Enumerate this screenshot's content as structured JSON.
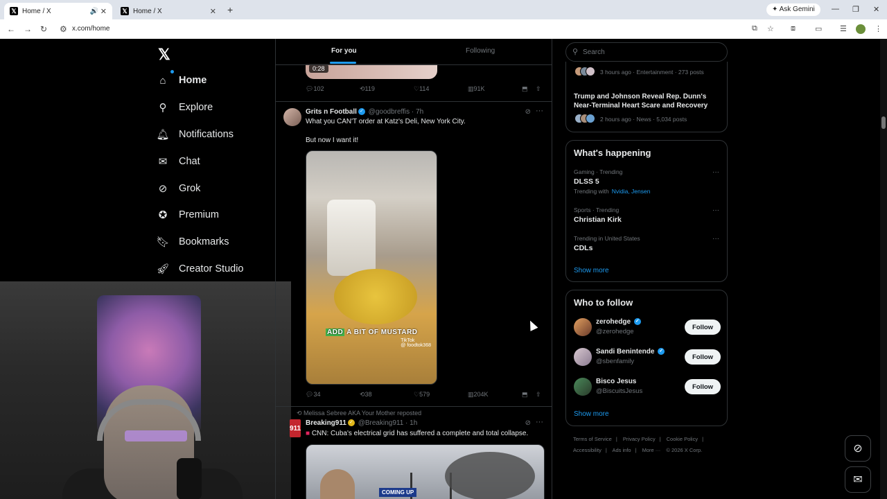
{
  "browser": {
    "tabs": [
      {
        "title": "Home / X",
        "active": true
      },
      {
        "title": "Home / X",
        "active": false
      }
    ],
    "new_tab": "+",
    "ask_gemini": "Ask Gemini",
    "url": "x.com/home"
  },
  "sidebar": {
    "items": [
      {
        "label": "Home",
        "icon": "home-icon"
      },
      {
        "label": "Explore",
        "icon": "search-icon"
      },
      {
        "label": "Notifications",
        "icon": "bell-icon"
      },
      {
        "label": "Chat",
        "icon": "mail-icon"
      },
      {
        "label": "Grok",
        "icon": "grok-icon"
      },
      {
        "label": "Premium",
        "icon": "verified-icon"
      },
      {
        "label": "Bookmarks",
        "icon": "bookmark-icon"
      },
      {
        "label": "Creator Studio",
        "icon": "rocket-icon"
      }
    ]
  },
  "feed": {
    "tabs": [
      {
        "label": "For you",
        "active": true
      },
      {
        "label": "Following",
        "active": false
      }
    ],
    "prev_post": {
      "video_time": "0:28",
      "replies": "102",
      "reposts": "119",
      "likes": "114",
      "views": "91K"
    },
    "posts": [
      {
        "name": "Grits n Football",
        "handle": "@goodbreffis",
        "time": "7h",
        "text1": "What you CAN'T order at Katz's Deli, New York City.",
        "text2": "But now I want it!",
        "caption_highlight": "ADD",
        "caption_rest": " A BIT OF MUSTARD",
        "tiktok_label": "TikTok",
        "tiktok_handle": "@ foodtok368",
        "replies": "34",
        "reposts": "38",
        "likes": "579",
        "views": "204K"
      },
      {
        "repost_by": "Melissa Sebree AKA Your Mother reposted",
        "name": "Breaking911",
        "handle": "@Breaking911",
        "time": "1h",
        "avatar_text": "911",
        "text1": "CNN: Cuba's electrical grid has suffered a complete and total collapse.",
        "media_banner": "COMING UP"
      }
    ]
  },
  "right": {
    "search_placeholder": "Search",
    "news": [
      {
        "meta": "3 hours ago · Entertainment · 273 posts"
      },
      {
        "title": "Trump and Johnson Reveal Rep. Dunn's Near-Terminal Heart Scare and Recovery",
        "meta": "2 hours ago · News · 5,034 posts"
      }
    ],
    "whats_happening": {
      "title": "What's happening",
      "trends": [
        {
          "context": "Gaming · Trending",
          "name": "DLSS 5",
          "with_label": "Trending with",
          "with": "Nvidia, Jensen"
        },
        {
          "context": "Sports · Trending",
          "name": "Christian Kirk"
        },
        {
          "context": "Trending in United States",
          "name": "CDLs"
        }
      ],
      "show_more": "Show more"
    },
    "who_to_follow": {
      "title": "Who to follow",
      "accounts": [
        {
          "name": "zerohedge",
          "handle": "@zerohedge",
          "button": "Follow"
        },
        {
          "name": "Sandi Benintende",
          "handle": "@sbenfamily",
          "button": "Follow"
        },
        {
          "name": "Bisco Jesus",
          "handle": "@BiscuitsJesus",
          "button": "Follow"
        }
      ],
      "show_more": "Show more"
    },
    "footer": [
      "Terms of Service",
      "|",
      "Privacy Policy",
      "|",
      "Cookie Policy",
      "|",
      "Accessibility",
      "|",
      "Ads info",
      "|",
      "More ···",
      "© 2026 X Corp."
    ]
  },
  "colors": {
    "accent": "#1d9bf0",
    "background": "#000000",
    "border": "#2f3336",
    "muted": "#71767b"
  }
}
